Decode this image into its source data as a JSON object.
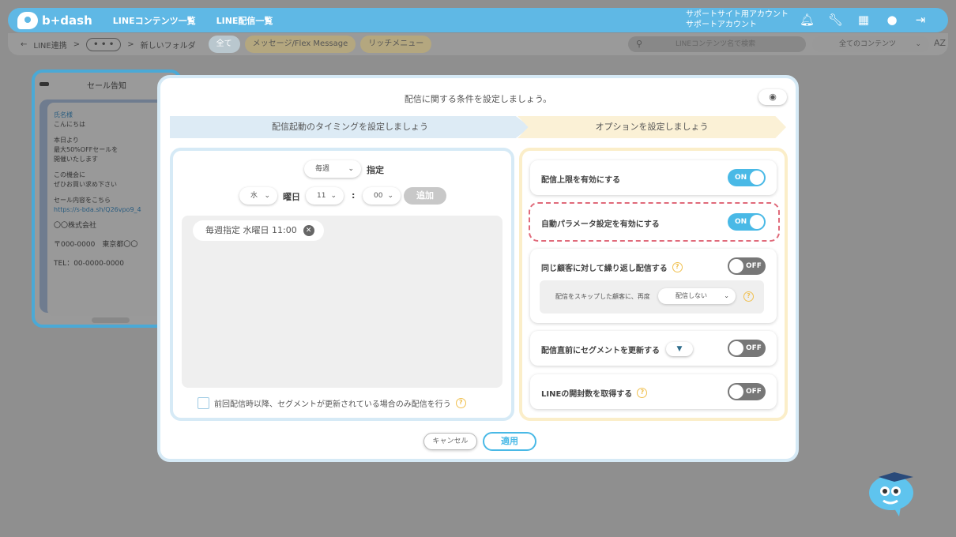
{
  "header": {
    "logo_text": "b+dash",
    "nav": [
      "LINEコンテンツ一覧",
      "LINE配信一覧"
    ],
    "support_line1": "サポートサイト用アカウント",
    "support_line2": "サポートアカウント",
    "icons": [
      "bell-icon",
      "wrench-icon",
      "grid-icon",
      "chat-icon",
      "logout-icon"
    ]
  },
  "subbar": {
    "back": "←",
    "crumb1": "LINE連携",
    "sep1": ">",
    "dots": "• • •",
    "sep2": ">",
    "crumb2": "新しいフォルダ",
    "tabs": [
      "全て",
      "メッセージ/Flex Message",
      "リッチメニュー"
    ],
    "search_placeholder": "LINEコンテンツ名で検索",
    "filter_value": "全てのコンテンツ",
    "sort_label": "AZ"
  },
  "bg_card": {
    "title": "セール告知",
    "lines": [
      "氏名様",
      "こんにちは",
      "本日より",
      "最大50%OFFセールを",
      "開催いたします",
      "この機会に",
      "ぜひお買い求め下さい",
      "セール内容をこちら",
      "https://s-bda.sh/Q26vpo9_4",
      "〇〇株式会社",
      "〒000-0000　東京都〇〇",
      "TEL：00-0000-0000"
    ]
  },
  "modal": {
    "title": "配信に関する条件を設定しましょう。",
    "step1": "配信起動のタイミングを設定しましょう",
    "step2": "オプションを設定しましょう",
    "timing": {
      "frequency": "毎週",
      "frequency_suffix": "指定",
      "weekday": "水",
      "weekday_suffix": "曜日",
      "hour": "11",
      "colon": ":",
      "minute": "00",
      "add_button": "追加",
      "schedule_chip": "毎週指定 水曜日 11:00",
      "condition_label": "前回配信時以降、セグメントが更新されている場合のみ配信を行う"
    },
    "options": [
      {
        "label": "配信上限を有効にする",
        "state": "ON"
      },
      {
        "label": "自動パラメータ設定を有効にする",
        "state": "ON"
      },
      {
        "label": "同じ顧客に対して繰り返し配信する",
        "state": "OFF"
      },
      {
        "label": "配信直前にセグメントを更新する",
        "state": "OFF"
      },
      {
        "label": "LINEの開封数を取得する",
        "state": "OFF"
      }
    ],
    "repeat_sub": {
      "text": "配信をスキップした顧客に、再度",
      "select_value": "配信しない"
    },
    "cancel": "キャンセル",
    "apply": "適用"
  },
  "colors": {
    "accent": "#49b9e6",
    "highlight": "#e06a7a",
    "toggle_off": "#777777"
  }
}
